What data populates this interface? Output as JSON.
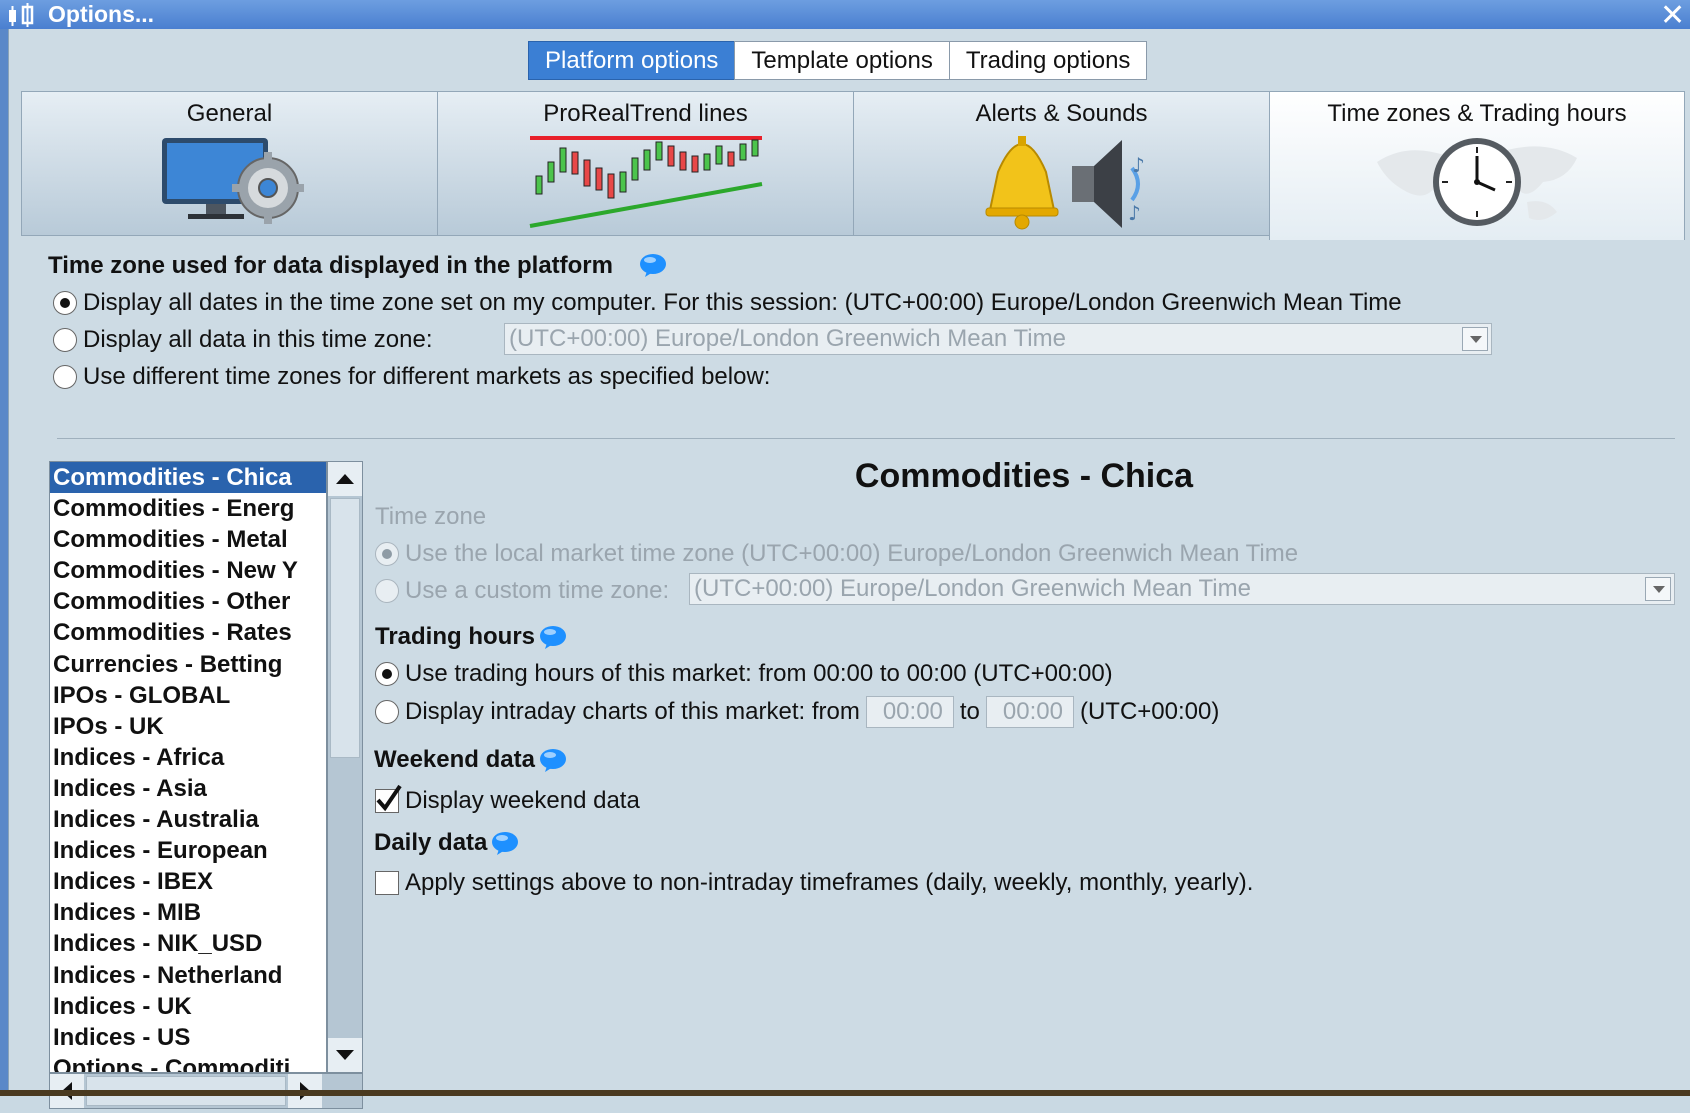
{
  "window": {
    "title": "Options...",
    "close_glyph": "✕"
  },
  "top_tabs": [
    {
      "label": "Platform options",
      "active": true
    },
    {
      "label": "Template options",
      "active": false
    },
    {
      "label": "Trading options",
      "active": false
    }
  ],
  "icon_tabs": [
    {
      "label": "General",
      "icon": "monitor-gear-icon",
      "active": false
    },
    {
      "label": "ProRealTrend lines",
      "icon": "trend-chart-icon",
      "active": false
    },
    {
      "label": "Alerts & Sounds",
      "icon": "bell-speaker-icon",
      "active": false
    },
    {
      "label": "Time zones & Trading hours",
      "icon": "world-clock-icon",
      "active": true
    }
  ],
  "timezone_section": {
    "title": "Time zone used for data displayed in the platform",
    "options": [
      {
        "label": "Display all dates in the time zone set on my computer. For this session:  (UTC+00:00) Europe/London Greenwich Mean Time",
        "selected": true
      },
      {
        "label": "Display all data in this time zone:",
        "selected": false
      },
      {
        "label": "Use different time zones for different markets as specified below:",
        "selected": false
      }
    ],
    "combo_value": "(UTC+00:00) Europe/London Greenwich Mean Time"
  },
  "markets": [
    "Commodities - Chica",
    "Commodities - Energ",
    "Commodities - Metal",
    "Commodities - New Y",
    "Commodities - Other",
    "Commodities - Rates",
    "Currencies - Betting",
    "IPOs - GLOBAL",
    "IPOs - UK",
    "Indices - Africa",
    "Indices - Asia",
    "Indices - Australia",
    "Indices - European",
    "Indices - IBEX",
    "Indices - MIB",
    "Indices - NIK_USD",
    "Indices - Netherland",
    "Indices - UK",
    "Indices - US",
    "Options - Commoditi"
  ],
  "selected_market": "Commodities - Chica",
  "detail": {
    "title": "Commodities - Chica",
    "time_zone": {
      "title": "Time zone",
      "local_option": "Use the local market time zone (UTC+00:00) Europe/London Greenwich Mean Time",
      "custom_option": "Use a custom time zone:",
      "custom_value": "(UTC+00:00) Europe/London Greenwich Mean Time"
    },
    "trading_hours": {
      "title": "Trading hours",
      "option1": "Use trading hours of this market: from 00:00 to 00:00 (UTC+00:00)",
      "option2_prefix": "Display intraday charts of this market: from",
      "from": "00:00",
      "to_label": "to",
      "to": "00:00",
      "suffix": "(UTC+00:00)"
    },
    "weekend": {
      "title": "Weekend data",
      "checkbox_label": "Display weekend data",
      "checked": true
    },
    "daily": {
      "title": "Daily data",
      "checkbox_label": "Apply settings above to non-intraday timeframes (daily, weekly, monthly, yearly).",
      "checked": false
    }
  },
  "colors": {
    "accent": "#3b7fd4",
    "selection": "#2a63ad",
    "panel": "#cddbe4",
    "help": "#1e90ff"
  }
}
